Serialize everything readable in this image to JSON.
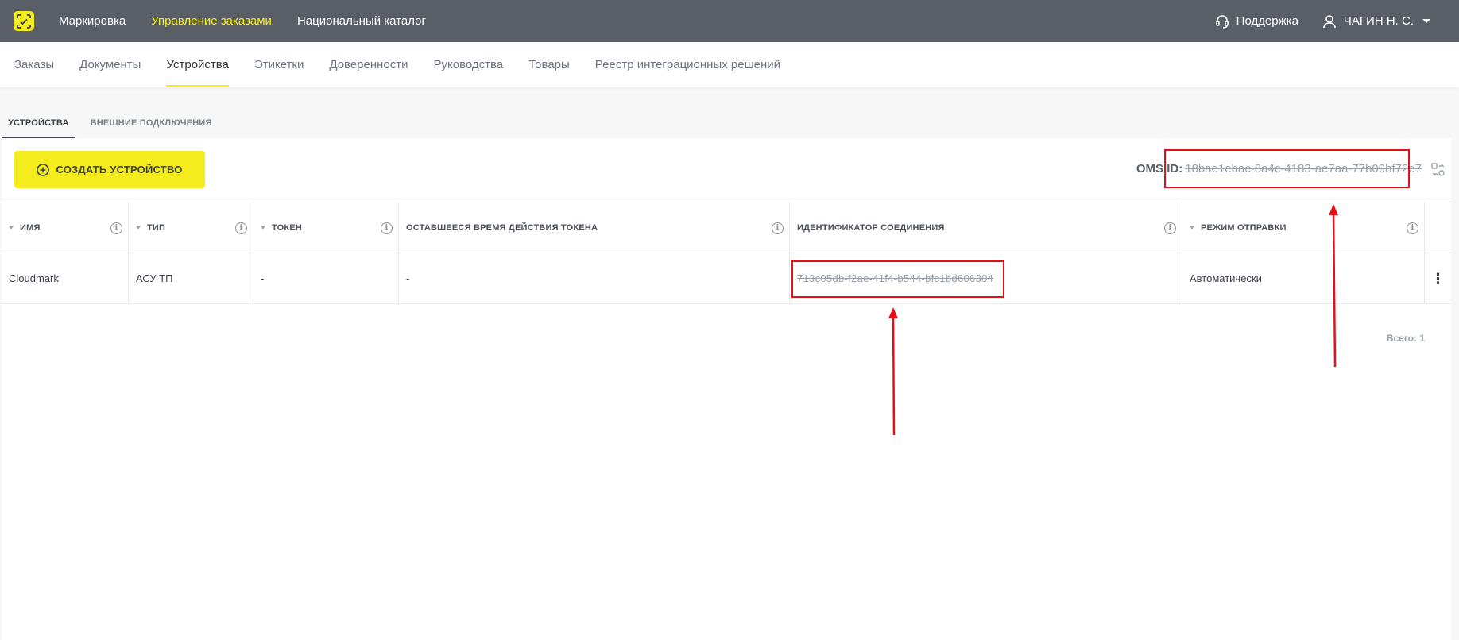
{
  "topbar": {
    "logo_icon": "scan-frame-icon",
    "nav": [
      "Маркировка",
      "Управление заказами",
      "Национальный каталог"
    ],
    "active_nav_index": 1,
    "support_label": "Поддержка",
    "user_label": "ЧАГИН Н. С."
  },
  "subnav": {
    "tabs": [
      "Заказы",
      "Документы",
      "Устройства",
      "Этикетки",
      "Доверенности",
      "Руководства",
      "Товары",
      "Реестр интеграционных решений"
    ],
    "active_index": 2
  },
  "innertabs": {
    "tabs": [
      "УСТРОЙСТВА",
      "ВНЕШНИЕ ПОДКЛЮЧЕНИЯ"
    ],
    "active_index": 0
  },
  "toolbar": {
    "create_label": "СОЗДАТЬ УСТРОЙСТВО",
    "oms_label": "OMS ID:",
    "oms_value": "18bae1ebac-8a4c-4183-ae7aa-77b09bf72e7"
  },
  "table": {
    "columns": [
      "ИМЯ",
      "ТИП",
      "ТОКЕН",
      "ОСТАВШЕЕСЯ ВРЕМЯ ДЕЙСТВИЯ ТОКЕНА",
      "ИДЕНТИФИКАТОР СОЕДИНЕНИЯ",
      "РЕЖИМ ОТПРАВКИ"
    ],
    "rows": [
      {
        "name": "Cloudmark",
        "type": "АСУ ТП",
        "token": "-",
        "token_time": "-",
        "connection_id": "713c05db-f2ae-41f4-b544-bfc1bd606304",
        "send_mode": "Автоматически"
      }
    ],
    "total": "Всего: 1"
  },
  "colors": {
    "accent": "#f4ec1c",
    "topbar_bg": "#5a5e66",
    "annotation_red": "#e3101a"
  }
}
